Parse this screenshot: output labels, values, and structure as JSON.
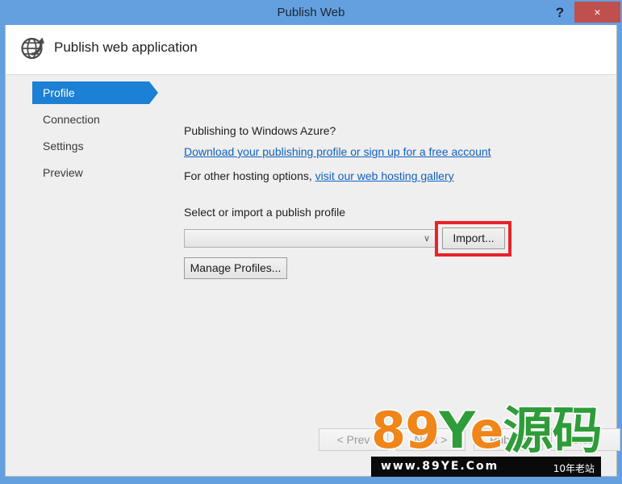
{
  "window": {
    "title": "Publish Web",
    "help_label": "?",
    "close_label": "×",
    "frame_color": "#64a0e0",
    "close_color": "#c0504d"
  },
  "header": {
    "title": "Publish web application",
    "icon": "globe-publish-icon"
  },
  "sidebar": {
    "items": [
      {
        "label": "Profile",
        "selected": true
      },
      {
        "label": "Connection",
        "selected": false
      },
      {
        "label": "Settings",
        "selected": false
      },
      {
        "label": "Preview",
        "selected": false
      }
    ],
    "selected_color": "#1c80d4"
  },
  "main": {
    "azure_prompt": "Publishing to Windows Azure?",
    "azure_link": "Download your publishing profile or sign up for a free account",
    "hosting_prefix": "For other hosting options,",
    "hosting_link": "visit our web hosting gallery",
    "profile_section_label": "Select or import a publish profile",
    "profile_combo": {
      "value": "",
      "placeholder": "",
      "chevron": "∨"
    },
    "import_button": "Import...",
    "manage_button": "Manage Profiles...",
    "highlight_color": "#e8232a"
  },
  "footer": {
    "prev_button": "< Prev",
    "next_button": "Next >",
    "publish_button": "Publish",
    "close_button": "Close"
  },
  "watermark": {
    "part_89": "89",
    "part_Y": "Y",
    "part_e": "e",
    "part_cn": "源码",
    "url": "www.89YE.Com",
    "tagline": "10年老站",
    "orange": "#f08519",
    "green": "#2f9c3a"
  }
}
